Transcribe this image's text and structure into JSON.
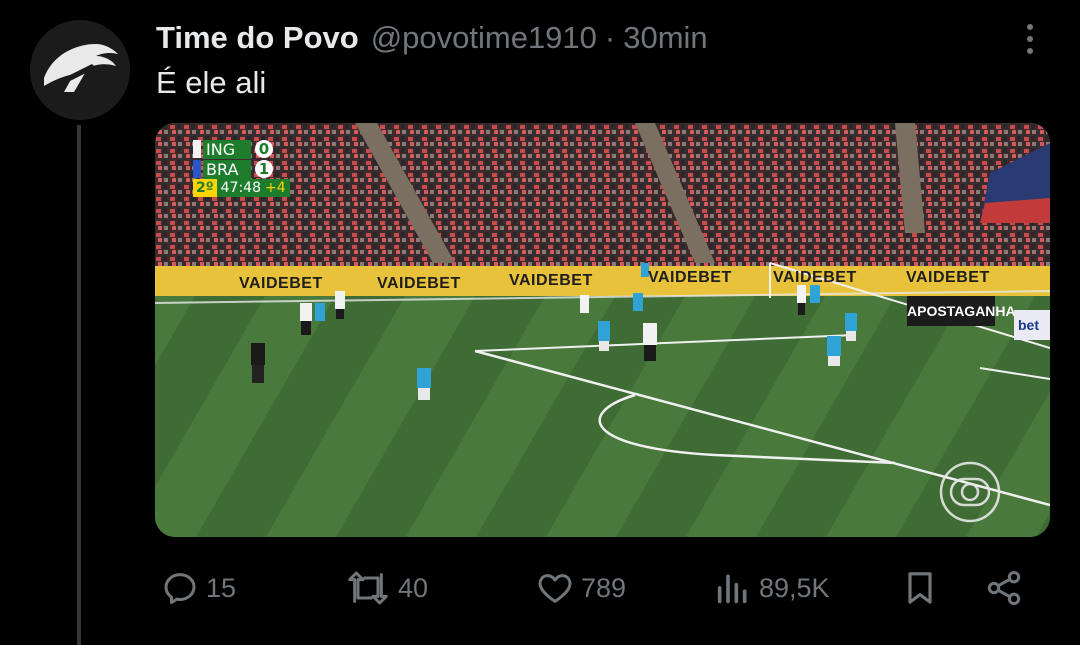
{
  "tweet": {
    "author_name": "Time do Povo",
    "handle": "@povotime1910",
    "separator": "·",
    "time": "30min",
    "text": "É ele ali"
  },
  "media": {
    "scorebug": {
      "team1": "ING",
      "score1": "0",
      "team2": "BRA",
      "score2": "1",
      "half": "2º",
      "clock": "47:48",
      "added": "+4"
    },
    "ads": {
      "board": "VAIDEBET",
      "side_ad_1": "APOSTAGANHA",
      "side_ad_2": "bet"
    },
    "broadcaster_icon": "globo-logo-icon"
  },
  "actions": {
    "replies": "15",
    "reposts": "40",
    "likes": "789",
    "views": "89,5K"
  },
  "colors": {
    "background": "#000000",
    "primary_text": "#e7e9ea",
    "secondary_text": "#71767b",
    "pitch_green": "#3f6a33"
  }
}
